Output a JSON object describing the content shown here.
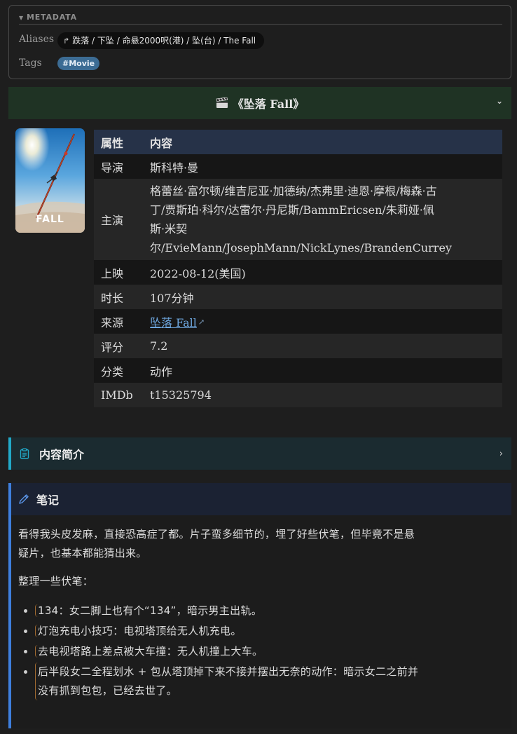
{
  "metadata": {
    "header": "METADATA",
    "aliases_key": "Aliases",
    "aliases_value": "跌落 / 下坠 / 命悬2000呎(港) / 坠(台) / The Fall",
    "tags_key": "Tags",
    "tag": "#Movie"
  },
  "movie": {
    "title": "《坠落 Fall》",
    "poster_title": "FALL",
    "table": {
      "header": [
        "属性",
        "内容"
      ],
      "rows": [
        {
          "key": "导演",
          "value": "斯科特·曼"
        },
        {
          "key": "主演",
          "lines": [
            "格蕾丝·富尔顿/维吉尼亚·加德纳/杰弗里·迪恩·摩根/梅森·古",
            "丁/贾斯珀·科尔/达雷尔·丹尼斯/BammEricsen/朱莉娅·佩",
            "斯·米契",
            "尔/EvieMann/JosephMann/NickLynes/BrandenCurrey"
          ]
        },
        {
          "key": "上映",
          "value": "2022-08-12(美国)"
        },
        {
          "key": "时长",
          "value": "107分钟"
        },
        {
          "key": "来源",
          "value": "坠落 Fall"
        },
        {
          "key": "评分",
          "value": "7.2"
        },
        {
          "key": "分类",
          "value": "动作"
        },
        {
          "key": "IMDb",
          "value": "t15325794"
        }
      ]
    }
  },
  "synopsis": {
    "title": "内容简介"
  },
  "notes": {
    "title": "笔记",
    "p1_lines": [
      "看得我头皮发麻，直接恐高症了都。片子蛮多细节的，埋了好些伏笔，但毕竟不是悬",
      "疑片，也基本都能猜出来。"
    ],
    "p2": "整理一些伏笔：",
    "items": [
      "134：女二脚上也有个“134”，暗示男主出轨。",
      "灯泡充电小技巧：电视塔顶给无人机充电。",
      "去电视塔路上差点被大车撞：无人机撞上大车。"
    ],
    "item4_lines": [
      "后半段女二全程划水 + 包从塔顶掉下来不接并摆出无奈的动作：暗示女二之前并",
      "没有抓到包包，已经去世了。"
    ]
  },
  "colors": {
    "background": "#1e1e1e",
    "movie_callout": "#1f3324",
    "synopsis_accent": "#22a9c8",
    "notes_accent": "#3e7fdd",
    "tag": "#3c6c94",
    "link": "#6fa8e0"
  },
  "icons": [
    "triangle-down-icon",
    "alias-arrow-icon",
    "clapperboard-icon",
    "chevron-down-icon",
    "clipboard-icon",
    "chevron-right-icon",
    "pencil-icon",
    "external-link-icon"
  ]
}
